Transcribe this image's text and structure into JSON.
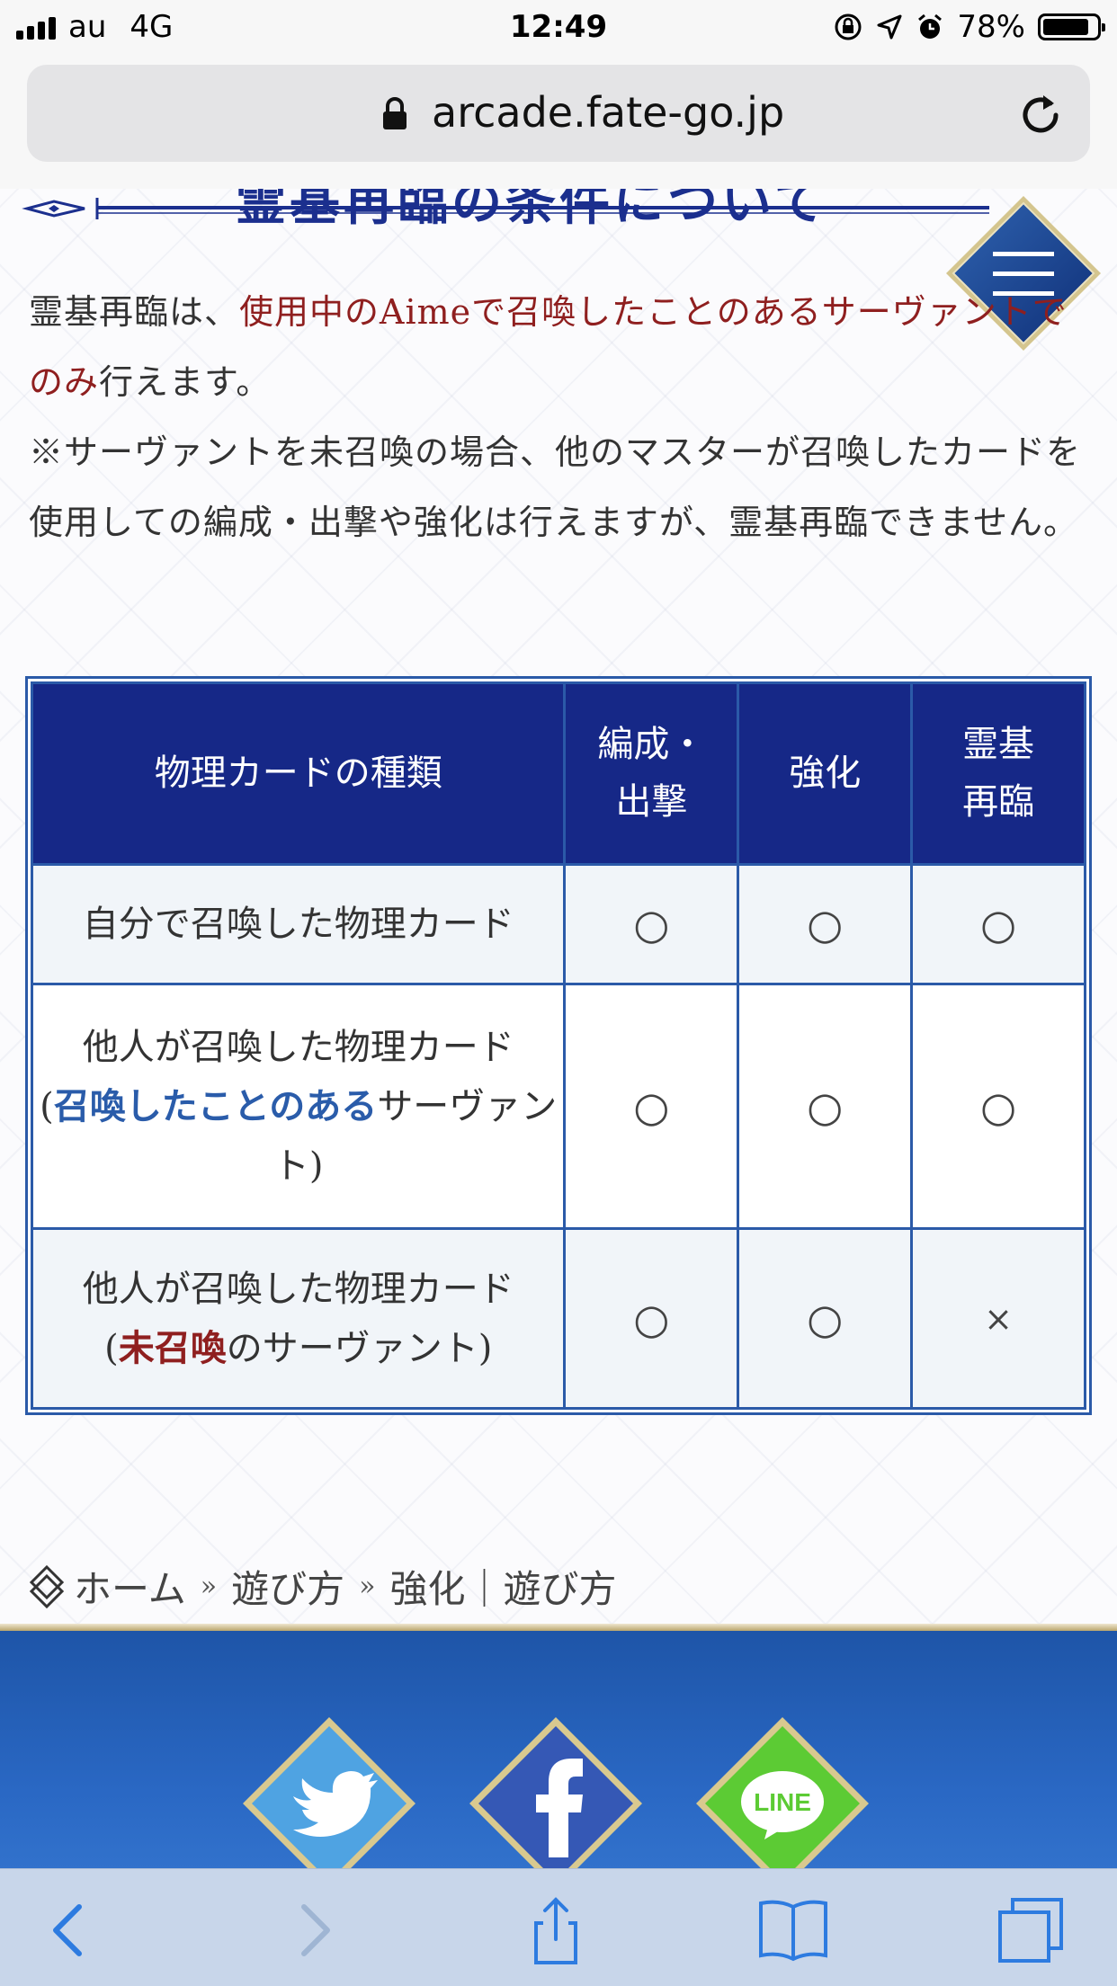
{
  "status_bar": {
    "carrier": "au",
    "network": "4G",
    "time": "12:49",
    "battery": "78%",
    "battery_level": 0.78
  },
  "browser": {
    "url": "arcade.fate-go.jp"
  },
  "page": {
    "heading_partial": "霊基再臨の条件について",
    "intro_line1_a": "霊基再臨は、",
    "intro_line1_red": "使用中のAimeで召喚したことのあるサーヴァントでのみ",
    "intro_line1_b": "行えます。",
    "intro_line2": "※サーヴァントを未召喚の場合、他のマスターが召喚したカードを使用しての編成・出撃や強化は行えますが、霊基再臨できません。"
  },
  "table": {
    "headers": {
      "col1": "物理カードの種類",
      "col2_l1": "編成・",
      "col2_l2": "出撃",
      "col3": "強化",
      "col4_l1": "霊基",
      "col4_l2": "再臨"
    },
    "rows": [
      {
        "label": "自分で召喚した物理カード",
        "formation": "○",
        "enhance": "○",
        "ascension": "○"
      },
      {
        "label_a": "他人が召喚した物理カード",
        "label_paren_open": "(",
        "label_blue": "召喚したことのある",
        "label_b": "サーヴァント",
        "label_paren_close": ")",
        "formation": "○",
        "enhance": "○",
        "ascension": "○"
      },
      {
        "label_a": "他人が召喚した物理カード",
        "label_paren_open": "(",
        "label_red": "未召喚",
        "label_b": "のサーヴァント",
        "label_paren_close": ")",
        "formation": "○",
        "enhance": "○",
        "ascension": "×"
      }
    ]
  },
  "breadcrumb": {
    "home": "ホーム",
    "sep": "»",
    "howto": "遊び方",
    "current": "強化｜遊び方"
  },
  "social": {
    "twitter": "twitter-icon",
    "facebook": "facebook-icon",
    "line": "LINE"
  },
  "colors": {
    "header_navy": "#162887",
    "border_blue": "#2b5aa8",
    "accent_red": "#8f1f1f",
    "accent_blue": "#2a5caa"
  }
}
